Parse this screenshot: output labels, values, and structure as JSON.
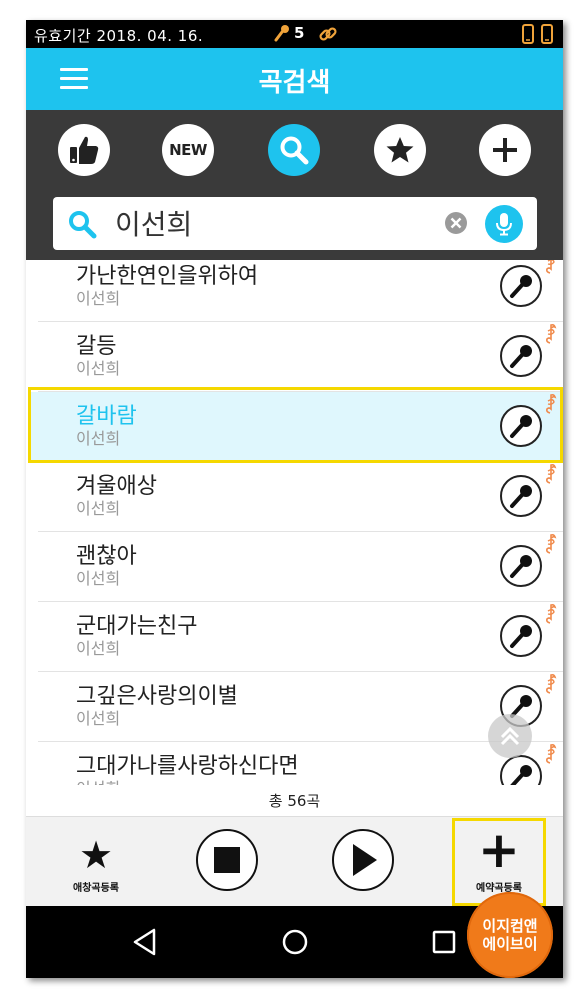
{
  "status_bar": {
    "expiry": "유효기간  2018. 04. 16.",
    "mic_count": "5"
  },
  "header": {
    "title": "곡검색"
  },
  "categories": [
    {
      "name": "popular",
      "icon": "thumbs-up-icon"
    },
    {
      "name": "new",
      "label": "NEW",
      "icon": "new-icon"
    },
    {
      "name": "search",
      "icon": "search-icon",
      "active": true
    },
    {
      "name": "favorites",
      "icon": "star-icon"
    },
    {
      "name": "add",
      "icon": "plus-icon"
    }
  ],
  "search": {
    "value": "이선희",
    "placeholder": ""
  },
  "songs": [
    {
      "title": "가난한연인을위하여",
      "artist": "이선희"
    },
    {
      "title": "갈등",
      "artist": "이선희"
    },
    {
      "title": "갈바람",
      "artist": "이선희",
      "selected": true
    },
    {
      "title": "겨울애상",
      "artist": "이선희"
    },
    {
      "title": "괜찮아",
      "artist": "이선희"
    },
    {
      "title": "군대가는친구",
      "artist": "이선희"
    },
    {
      "title": "그깊은사랑의이별",
      "artist": "이선희"
    },
    {
      "title": "그대가나를사랑하신다면",
      "artist": "이선희"
    }
  ],
  "total": "총 56곡",
  "controls": {
    "favorite_label": "애창곡등록",
    "reserve_label": "예약곡등록"
  },
  "badge": {
    "line1": "이지컴앤",
    "line2": "에이브이"
  },
  "colors": {
    "accent": "#1ec3ee",
    "dark_bar": "#3a3a3a",
    "highlight": "#f5d800",
    "selected_bg": "#dff7fd",
    "note": "#f08a4b",
    "badge": "#f07a1a"
  }
}
